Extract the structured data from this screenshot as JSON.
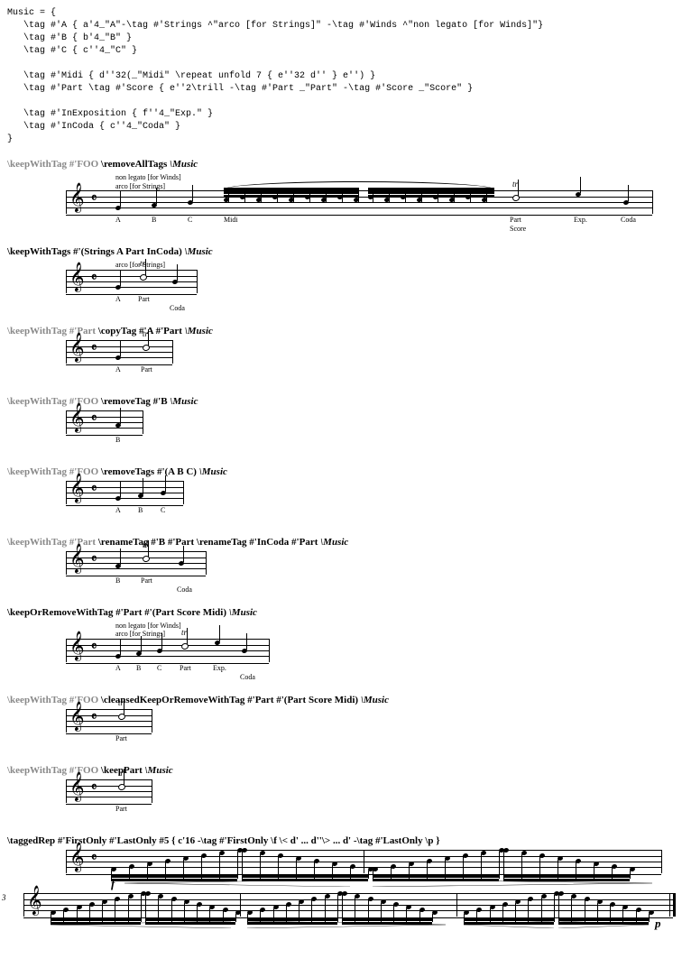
{
  "code": "Music = {\n   \\tag #'A { a'4_\"A\"-\\tag #'Strings ^\"arco [for Strings]\" -\\tag #'Winds ^\"non legato [for Winds]\"}\n   \\tag #'B { b'4_\"B\" }\n   \\tag #'C { c''4_\"C\" }\n\n   \\tag #'Midi { d''32(_\"Midi\" \\repeat unfold 7 { e''32 d'' } e'') }\n   \\tag #'Part \\tag #'Score { e''2\\trill -\\tag #'Part _\"Part\" -\\tag #'Score _\"Score\" }\n\n   \\tag #'InExposition { f''4_\"Exp.\" }\n   \\tag #'InCoda { c''4_\"Coda\" }\n}",
  "ex1": {
    "prefix": "\\keepWithTag #'FOO ",
    "cmd": "\\removeAllTags ",
    "arg": "\\Music",
    "ann1": "non legato [for Winds]",
    "ann2": "arco [for Strings]",
    "labels": {
      "A": "A",
      "B": "B",
      "C": "C",
      "Midi": "Midi",
      "Part": "Part",
      "Score": "Score",
      "Exp": "Exp.",
      "Coda": "Coda"
    },
    "trill": "tr"
  },
  "ex2": {
    "cmd": "\\keepWithTags #'(Strings A Part InCoda) ",
    "arg": "\\Music",
    "ann": "arco [for Strings]",
    "labels": {
      "A": "A",
      "Part": "Part",
      "Coda": "Coda"
    },
    "trill": "tr"
  },
  "ex3": {
    "prefix": "\\keepWithTag #'Part ",
    "cmd": "\\copyTag #'A #'Part ",
    "arg": "\\Music",
    "labels": {
      "A": "A",
      "Part": "Part"
    },
    "trill": "tr"
  },
  "ex4": {
    "prefix": "\\keepWithTag #'FOO ",
    "cmd": "\\removeTag #'B ",
    "arg": "\\Music",
    "labels": {
      "B": "B"
    }
  },
  "ex5": {
    "prefix": "\\keepWithTag #'FOO ",
    "cmd": "\\removeTags #'(A B C) ",
    "arg": "\\Music",
    "labels": {
      "A": "A",
      "B": "B",
      "C": "C"
    }
  },
  "ex6": {
    "prefix": "\\keepWithTag #'Part ",
    "cmd": "\\renameTag #'B #'Part \\renameTag #'InCoda #'Part ",
    "arg": "\\Music",
    "labels": {
      "B": "B",
      "Part": "Part",
      "Coda": "Coda"
    },
    "trill": "tr"
  },
  "ex7": {
    "cmd": "\\keepOrRemoveWithTag #'Part #'(Part Score Midi) ",
    "arg": "\\Music",
    "ann1": "non legato [for Winds]",
    "ann2": "arco [for Strings]",
    "labels": {
      "A": "A",
      "B": "B",
      "C": "C",
      "Part": "Part",
      "Exp": "Exp.",
      "Coda": "Coda"
    },
    "trill": "tr"
  },
  "ex8": {
    "prefix": "\\keepWithTag #'FOO ",
    "cmd": "\\cleansedKeepOrRemoveWithTag #'Part #'(Part Score Midi) ",
    "arg": "\\Music",
    "labels": {
      "Part": "Part"
    },
    "trill": "tr"
  },
  "ex9": {
    "prefix": "\\keepWithTag #'FOO ",
    "cmd": "\\keepPart ",
    "arg": "\\Music",
    "labels": {
      "Part": "Part"
    },
    "trill": "tr"
  },
  "ex10": {
    "cmd": "\\taggedRep #'FirstOnly #'LastOnly #5   ",
    "arg": "{ c'16 -\\tag #'FirstOnly \\f \\< d' ... d''\\> ... d' -\\tag #'LastOnly \\p }",
    "bar": "3",
    "dynF": "f",
    "dynP": "p"
  },
  "glyphs": {
    "clef": "𝄞",
    "timesig": "𝄴"
  }
}
